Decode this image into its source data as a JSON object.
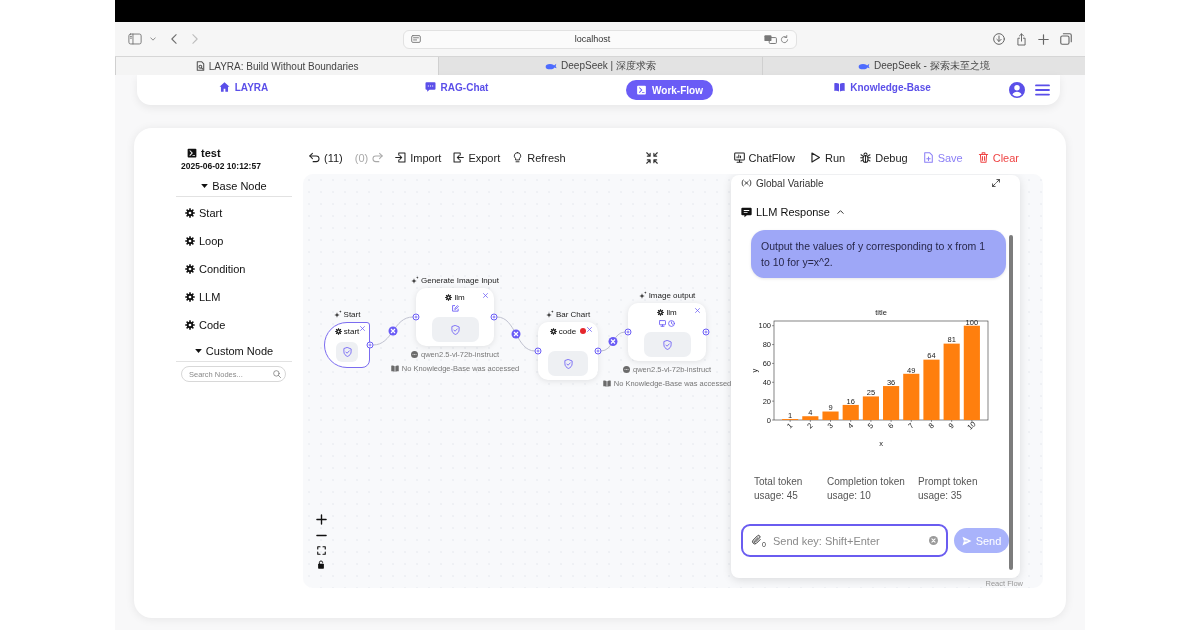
{
  "browser": {
    "address": "localhost",
    "tabs": [
      {
        "title": "LAYRA: Build Without Boundaries",
        "selected": true
      },
      {
        "title": "DeepSeek | 深度求索",
        "selected": false
      },
      {
        "title": "DeepSeek - 探索未至之境",
        "selected": false
      }
    ]
  },
  "navbar": {
    "items": [
      {
        "label": "LAYRA",
        "selected": false
      },
      {
        "label": "RAG-Chat",
        "selected": false
      },
      {
        "label": "Work-Flow",
        "selected": true
      },
      {
        "label": "Knowledge-Base",
        "selected": false
      }
    ]
  },
  "workflow": {
    "name": "test",
    "saved_at": "2025-06-02 10:12:57"
  },
  "sidebar": {
    "sections": [
      {
        "title": "Base Node",
        "expanded": true,
        "items": [
          {
            "label": "Start"
          },
          {
            "label": "Loop"
          },
          {
            "label": "Condition"
          },
          {
            "label": "LLM"
          },
          {
            "label": "Code"
          }
        ]
      },
      {
        "title": "Custom Node",
        "expanded": true
      }
    ],
    "search": {
      "placeholder": "Search Nodes..."
    }
  },
  "toolbar": {
    "history": [
      {
        "label": "(11)",
        "disabled": false
      },
      {
        "label": "(0)",
        "disabled": true
      }
    ],
    "actions": [
      {
        "label": "Import"
      },
      {
        "label": "Export"
      },
      {
        "label": "Refresh"
      }
    ],
    "run_actions": [
      {
        "label": "ChatFlow",
        "kind": "plain"
      },
      {
        "label": "Run",
        "kind": "plain"
      },
      {
        "label": "Debug",
        "kind": "plain"
      },
      {
        "label": "Save",
        "kind": "primary"
      },
      {
        "label": "Clear",
        "kind": "danger"
      }
    ]
  },
  "canvas": {
    "nodes": [
      {
        "title": "Start",
        "name": "start",
        "kind": "start",
        "selected": true
      },
      {
        "title": "Generate Image Input",
        "name": "llm",
        "kind": "llm",
        "selected": false,
        "model": "qwen2.5-vl-72b-instruct",
        "knowledge": "No Knowledge-Base was accessed"
      },
      {
        "title": "Bar Chart",
        "name": "code",
        "kind": "code",
        "selected": false,
        "color": "#e5262d"
      },
      {
        "title": "Image output",
        "name": "llm",
        "kind": "llm",
        "selected": false,
        "model": "qwen2.5-vl-72b-instruct",
        "knowledge": "No Knowledge-Base was accessed"
      }
    ],
    "attribution": "React Flow"
  },
  "panel": {
    "variables_title": "Global Variable",
    "response": {
      "title": "LLM Response",
      "expanded": true,
      "message": "Output the values of y corresponding to x from 1 to 10 for y=x^2.",
      "chart_data": {
        "type": "bar",
        "title": "title",
        "xlabel": "x",
        "ylabel": "y",
        "categories": [
          "1",
          "2",
          "3",
          "4",
          "5",
          "6",
          "7",
          "8",
          "9",
          "10"
        ],
        "values": [
          1,
          4,
          9,
          16,
          25,
          36,
          49,
          64,
          81,
          100
        ],
        "ylim": [
          0,
          105
        ],
        "yticks": [
          0,
          20,
          40,
          60,
          80,
          100
        ],
        "data_labels": true
      },
      "usage": [
        "Total token usage: 45",
        "Completion token usage: 10",
        "Prompt token usage: 35"
      ]
    },
    "input": {
      "placeholder": "Send key: Shift+Enter",
      "attachments": "0"
    },
    "send": "Send"
  }
}
